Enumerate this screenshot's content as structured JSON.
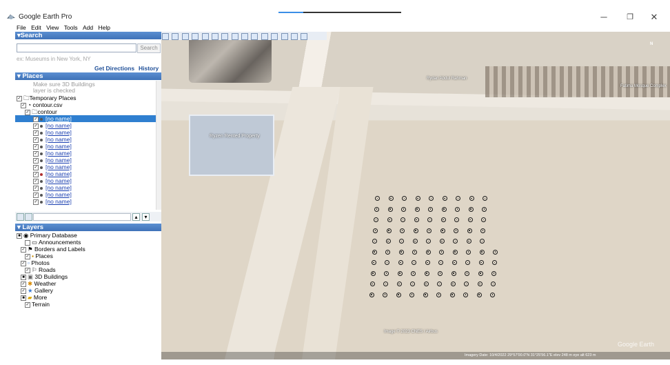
{
  "window": {
    "title": "Google Earth Pro",
    "minimize_glyph": "─",
    "restore_glyph": "❐",
    "close_glyph": "✕",
    "progress_fraction": 0.2
  },
  "menu": [
    "File",
    "Edit",
    "View",
    "Tools",
    "Add",
    "Help"
  ],
  "search": {
    "header": "▾Search",
    "button": "Search",
    "placeholder": "ex: Museums in New York, NY",
    "get_directions": "Get Directions",
    "history": "History"
  },
  "places": {
    "header": "▾ Places",
    "hint_line1": "Make sure 3D Buildings",
    "hint_line2": "layer is checked",
    "temporary": "Temporary Places",
    "file": "contour.csv",
    "folder": "contour",
    "items": [
      "[no name]",
      "[no name]",
      "[no name]",
      "[no name]",
      "[no name]",
      "[no name]",
      "[no name]",
      "[no name]",
      "[no name]",
      "[no name]",
      "[no name]",
      "[no name]",
      "[no name]"
    ]
  },
  "layers": {
    "header": "▾ Layers",
    "items": [
      "Primary Database",
      "Announcements",
      "Borders and Labels",
      "Places",
      "Photos",
      "Roads",
      "3D Buildings",
      "Weather",
      "Gallery",
      "More",
      "Terrain"
    ]
  },
  "map": {
    "label_center": "Ryzen Rented Property",
    "label_tr": "Rydan Abdul Rahman",
    "label_r": "Fatima Mosque Complex",
    "copyright": "Image © 2023 CNES / Airbus",
    "status": "Imagery Date: 10/4/2022    29°57'00.0\"N  31°25'56.1\"E  elev 248 m  eye alt 623 m",
    "watermark": "Google Earth",
    "north": "N"
  },
  "colors": {
    "header_blue": "#3f72b8",
    "selection": "#2f7fd0",
    "link": "#1a3fb0"
  }
}
